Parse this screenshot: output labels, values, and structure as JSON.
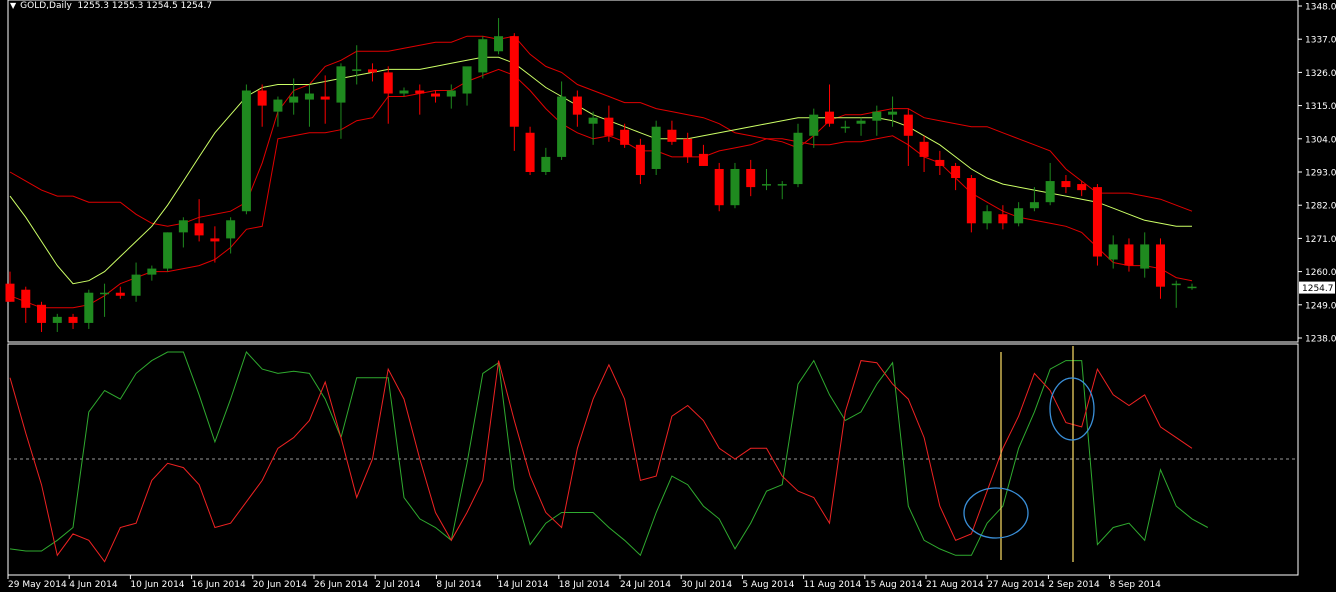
{
  "header": {
    "symbol": "GOLD,Daily",
    "ohlc": "1255.3 1255.3 1254.5 1254.7"
  },
  "colors": {
    "background": "#000000",
    "bull": "#1f8a1f",
    "bear": "#ff0000",
    "ma": "#ccff66",
    "envelope": "#e00000",
    "osc_green": "#2faa2f",
    "osc_red": "#ee2222",
    "marker_line": "#ffe066",
    "circle": "#3a8fd8"
  },
  "chart_data": [
    {
      "type": "candlestick",
      "title": "GOLD,Daily",
      "ylim": [
        1238,
        1348
      ],
      "price_ticks": [
        "1348.0",
        "1337.0",
        "1326.0",
        "1315.0",
        "1304.0",
        "1293.0",
        "1282.0",
        "1271.0",
        "1260.0",
        "1249.0",
        "1238.0"
      ],
      "current_price_label": "1254.7",
      "x_labels": [
        "29 May 2014",
        "4 Jun 2014",
        "10 Jun 2014",
        "16 Jun 2014",
        "20 Jun 2014",
        "26 Jun 2014",
        "2 Jul 2014",
        "8 Jul 2014",
        "14 Jul 2014",
        "18 Jul 2014",
        "24 Jul 2014",
        "30 Jul 2014",
        "5 Aug 2014",
        "11 Aug 2014",
        "15 Aug 2014",
        "21 Aug 2014",
        "27 Aug 2014",
        "2 Sep 2014",
        "8 Sep 2014"
      ],
      "candles": [
        {
          "o": 1256,
          "h": 1260,
          "l": 1250,
          "c": 1250
        },
        {
          "o": 1254,
          "h": 1255,
          "l": 1243,
          "c": 1248
        },
        {
          "o": 1249,
          "h": 1250,
          "l": 1240,
          "c": 1243
        },
        {
          "o": 1243,
          "h": 1246,
          "l": 1240,
          "c": 1245
        },
        {
          "o": 1245,
          "h": 1246,
          "l": 1241,
          "c": 1243
        },
        {
          "o": 1243,
          "h": 1254,
          "l": 1241,
          "c": 1253
        },
        {
          "o": 1253,
          "h": 1256,
          "l": 1245,
          "c": 1253
        },
        {
          "o": 1253,
          "h": 1255,
          "l": 1251,
          "c": 1252
        },
        {
          "o": 1252,
          "h": 1263,
          "l": 1250,
          "c": 1259
        },
        {
          "o": 1259,
          "h": 1262,
          "l": 1257,
          "c": 1261
        },
        {
          "o": 1261,
          "h": 1273,
          "l": 1260,
          "c": 1273
        },
        {
          "o": 1273,
          "h": 1278,
          "l": 1268,
          "c": 1277
        },
        {
          "o": 1276,
          "h": 1284,
          "l": 1270,
          "c": 1272
        },
        {
          "o": 1271,
          "h": 1275,
          "l": 1263,
          "c": 1270
        },
        {
          "o": 1271,
          "h": 1278,
          "l": 1266,
          "c": 1277
        },
        {
          "o": 1280,
          "h": 1322,
          "l": 1279,
          "c": 1320
        },
        {
          "o": 1320,
          "h": 1322,
          "l": 1308,
          "c": 1315
        },
        {
          "o": 1313,
          "h": 1318,
          "l": 1308,
          "c": 1317
        },
        {
          "o": 1316,
          "h": 1324,
          "l": 1312,
          "c": 1318
        },
        {
          "o": 1317,
          "h": 1322,
          "l": 1308,
          "c": 1319
        },
        {
          "o": 1318,
          "h": 1325,
          "l": 1309,
          "c": 1317
        },
        {
          "o": 1316,
          "h": 1329,
          "l": 1304,
          "c": 1328
        },
        {
          "o": 1327,
          "h": 1335,
          "l": 1322,
          "c": 1327
        },
        {
          "o": 1327,
          "h": 1329,
          "l": 1323,
          "c": 1326
        },
        {
          "o": 1326,
          "h": 1328,
          "l": 1309,
          "c": 1319
        },
        {
          "o": 1319,
          "h": 1321,
          "l": 1318,
          "c": 1320
        },
        {
          "o": 1320,
          "h": 1322,
          "l": 1312,
          "c": 1319
        },
        {
          "o": 1319,
          "h": 1320,
          "l": 1316,
          "c": 1318
        },
        {
          "o": 1318,
          "h": 1322,
          "l": 1314,
          "c": 1320
        },
        {
          "o": 1319,
          "h": 1327,
          "l": 1315,
          "c": 1328
        },
        {
          "o": 1326,
          "h": 1338,
          "l": 1324,
          "c": 1337
        },
        {
          "o": 1333,
          "h": 1344,
          "l": 1332,
          "c": 1338
        },
        {
          "o": 1338,
          "h": 1339,
          "l": 1300,
          "c": 1308
        },
        {
          "o": 1306,
          "h": 1308,
          "l": 1292,
          "c": 1293
        },
        {
          "o": 1293,
          "h": 1301,
          "l": 1292,
          "c": 1298
        },
        {
          "o": 1298,
          "h": 1323,
          "l": 1297,
          "c": 1318
        },
        {
          "o": 1318,
          "h": 1320,
          "l": 1308,
          "c": 1312
        },
        {
          "o": 1309,
          "h": 1313,
          "l": 1302,
          "c": 1311
        },
        {
          "o": 1311,
          "h": 1315,
          "l": 1303,
          "c": 1305
        },
        {
          "o": 1307,
          "h": 1309,
          "l": 1301,
          "c": 1302
        },
        {
          "o": 1302,
          "h": 1304,
          "l": 1289,
          "c": 1292
        },
        {
          "o": 1294,
          "h": 1310,
          "l": 1292,
          "c": 1308
        },
        {
          "o": 1307,
          "h": 1310,
          "l": 1302,
          "c": 1303
        },
        {
          "o": 1304,
          "h": 1306,
          "l": 1296,
          "c": 1298
        },
        {
          "o": 1299,
          "h": 1302,
          "l": 1295,
          "c": 1295
        },
        {
          "o": 1294,
          "h": 1296,
          "l": 1280,
          "c": 1282
        },
        {
          "o": 1282,
          "h": 1296,
          "l": 1281,
          "c": 1294
        },
        {
          "o": 1294,
          "h": 1297,
          "l": 1285,
          "c": 1288
        },
        {
          "o": 1289,
          "h": 1294,
          "l": 1287,
          "c": 1289
        },
        {
          "o": 1289,
          "h": 1290,
          "l": 1284,
          "c": 1289
        },
        {
          "o": 1289,
          "h": 1309,
          "l": 1288,
          "c": 1306
        },
        {
          "o": 1305,
          "h": 1314,
          "l": 1301,
          "c": 1312
        },
        {
          "o": 1313,
          "h": 1322,
          "l": 1308,
          "c": 1309
        },
        {
          "o": 1308,
          "h": 1310,
          "l": 1306,
          "c": 1308
        },
        {
          "o": 1309,
          "h": 1311,
          "l": 1305,
          "c": 1310
        },
        {
          "o": 1310,
          "h": 1315,
          "l": 1305,
          "c": 1313
        },
        {
          "o": 1312,
          "h": 1318,
          "l": 1308,
          "c": 1313
        },
        {
          "o": 1312,
          "h": 1314,
          "l": 1295,
          "c": 1305
        },
        {
          "o": 1303,
          "h": 1305,
          "l": 1293,
          "c": 1298
        },
        {
          "o": 1297,
          "h": 1300,
          "l": 1292,
          "c": 1295
        },
        {
          "o": 1295,
          "h": 1296,
          "l": 1287,
          "c": 1291
        },
        {
          "o": 1291,
          "h": 1292,
          "l": 1273,
          "c": 1276
        },
        {
          "o": 1276,
          "h": 1282,
          "l": 1274,
          "c": 1280
        },
        {
          "o": 1279,
          "h": 1282,
          "l": 1274,
          "c": 1276
        },
        {
          "o": 1276,
          "h": 1283,
          "l": 1275,
          "c": 1281
        },
        {
          "o": 1281,
          "h": 1288,
          "l": 1280,
          "c": 1283
        },
        {
          "o": 1283,
          "h": 1296,
          "l": 1282,
          "c": 1290
        },
        {
          "o": 1290,
          "h": 1292,
          "l": 1286,
          "c": 1288
        },
        {
          "o": 1289,
          "h": 1290,
          "l": 1285,
          "c": 1287
        },
        {
          "o": 1288,
          "h": 1289,
          "l": 1262,
          "c": 1265
        },
        {
          "o": 1264,
          "h": 1272,
          "l": 1261,
          "c": 1269
        },
        {
          "o": 1269,
          "h": 1271,
          "l": 1260,
          "c": 1262
        },
        {
          "o": 1261,
          "h": 1273,
          "l": 1258,
          "c": 1269
        },
        {
          "o": 1269,
          "h": 1271,
          "l": 1251,
          "c": 1255
        },
        {
          "o": 1256,
          "h": 1257,
          "l": 1248,
          "c": 1256
        },
        {
          "o": 1255,
          "h": 1256,
          "l": 1254,
          "c": 1255
        }
      ],
      "ma": [
        1285,
        1278,
        1270,
        1262,
        1256,
        1257,
        1260,
        1265,
        1270,
        1275,
        1282,
        1290,
        1298,
        1306,
        1312,
        1318,
        1321,
        1322,
        1322,
        1322,
        1323,
        1324,
        1325,
        1326,
        1327,
        1327,
        1327,
        1328,
        1329,
        1330,
        1331,
        1331,
        1329,
        1325,
        1321,
        1318,
        1315,
        1312,
        1310,
        1308,
        1306,
        1304,
        1304,
        1304,
        1305,
        1306,
        1307,
        1308,
        1309,
        1310,
        1311,
        1311,
        1311,
        1311,
        1311,
        1311,
        1310,
        1308,
        1305,
        1302,
        1298,
        1294,
        1291,
        1289,
        1288,
        1287,
        1286,
        1285,
        1284,
        1283,
        1281,
        1279,
        1277,
        1276,
        1275,
        1275
      ],
      "env_upper": [
        1293,
        1290,
        1287,
        1285,
        1285,
        1283,
        1283,
        1283,
        1279,
        1276,
        1275,
        1276,
        1278,
        1279,
        1280,
        1283,
        1296,
        1313,
        1320,
        1322,
        1328,
        1330,
        1333,
        1333,
        1333,
        1334,
        1335,
        1336,
        1336,
        1338,
        1338,
        1337,
        1338,
        1332,
        1328,
        1326,
        1322,
        1320,
        1318,
        1316,
        1316,
        1314,
        1313,
        1312,
        1311,
        1309,
        1306,
        1305,
        1304,
        1303,
        1301,
        1305,
        1310,
        1312,
        1312,
        1313,
        1314,
        1314,
        1311,
        1310,
        1309,
        1308,
        1308,
        1306,
        1304,
        1302,
        1300,
        1294,
        1290,
        1286,
        1286,
        1286,
        1285,
        1284,
        1282,
        1280
      ],
      "env_lower": [
        1252,
        1250,
        1248,
        1248,
        1248,
        1249,
        1252,
        1256,
        1258,
        1260,
        1260,
        1261,
        1262,
        1264,
        1268,
        1274,
        1275,
        1304,
        1305,
        1306,
        1306,
        1307,
        1310,
        1311,
        1318,
        1318,
        1319,
        1320,
        1320,
        1323,
        1325,
        1327,
        1325,
        1320,
        1314,
        1309,
        1306,
        1304,
        1305,
        1303,
        1300,
        1300,
        1298,
        1298,
        1298,
        1300,
        1301,
        1302,
        1304,
        1304,
        1303,
        1302,
        1302,
        1303,
        1303,
        1304,
        1305,
        1302,
        1298,
        1296,
        1291,
        1286,
        1283,
        1280,
        1278,
        1277,
        1276,
        1275,
        1273,
        1268,
        1263,
        1262,
        1262,
        1261,
        1258,
        1257
      ]
    },
    {
      "type": "line",
      "series": [
        {
          "values": [
            8,
            7,
            7,
            12,
            18,
            72,
            82,
            78,
            90,
            96,
            100,
            100,
            80,
            58,
            78,
            100,
            92,
            90,
            91,
            90,
            78,
            60,
            88,
            88,
            88,
            32,
            22,
            18,
            12,
            48,
            90,
            95,
            36,
            10,
            20,
            25,
            25,
            25,
            18,
            12,
            5,
            25,
            42,
            38,
            28,
            22,
            8,
            20,
            35,
            38,
            85,
            96,
            80,
            68,
            72,
            85,
            95,
            28,
            12,
            8,
            5,
            5,
            20,
            28,
            55,
            72,
            92,
            96,
            96,
            10,
            18,
            20,
            12,
            45,
            28,
            22,
            18
          ]
        },
        {
          "values": [
            88,
            62,
            38,
            5,
            15,
            12,
            2,
            18,
            20,
            40,
            48,
            46,
            38,
            18,
            20,
            30,
            40,
            55,
            60,
            68,
            86,
            60,
            32,
            50,
            92,
            78,
            50,
            25,
            12,
            25,
            40,
            96,
            68,
            42,
            25,
            18,
            55,
            78,
            94,
            78,
            40,
            42,
            70,
            75,
            68,
            55,
            50,
            55,
            55,
            42,
            35,
            32,
            20,
            72,
            96,
            95,
            85,
            78,
            60,
            28,
            12,
            15,
            35,
            55,
            70,
            90,
            82,
            67,
            65,
            92,
            80,
            75,
            80,
            65,
            60,
            55
          ]
        }
      ],
      "ylim": [
        0,
        100
      ],
      "midline": 50
    }
  ]
}
